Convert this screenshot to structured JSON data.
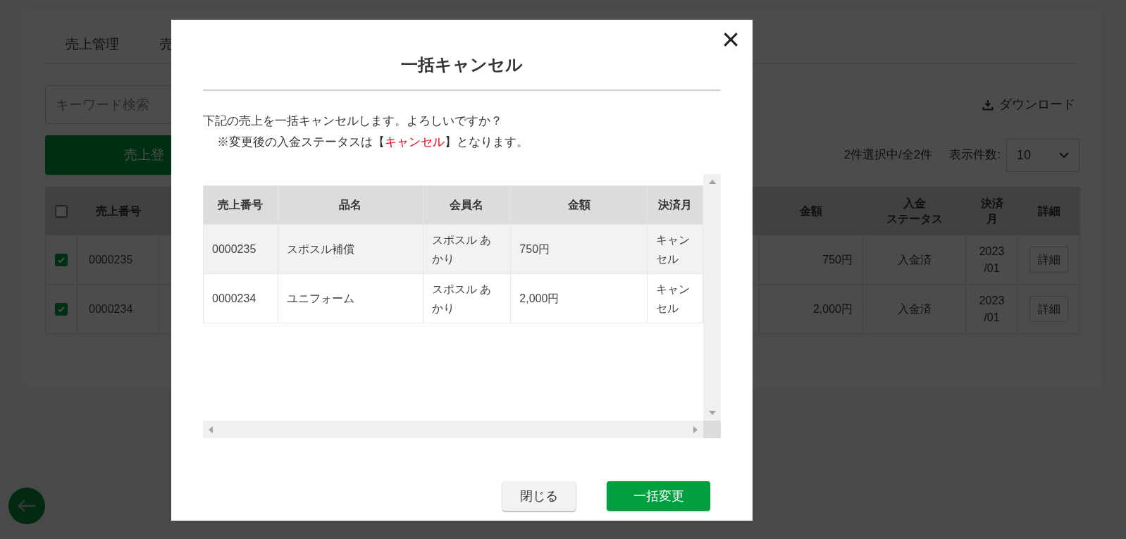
{
  "page": {
    "tabs": [
      "売上管理",
      "売"
    ],
    "search": {
      "placeholder": "キーワード検索"
    },
    "download": "ダウンロード",
    "register_button": "売上登",
    "selection_count": "2件選択中/全2件",
    "page_size": {
      "label": "表示件数:",
      "value": "10"
    },
    "table": {
      "header_checked": false,
      "columns": [
        {
          "lines": [
            "売上番号"
          ]
        },
        {
          "lines": [
            "金額"
          ]
        },
        {
          "lines": [
            "入金",
            "ステータス"
          ]
        },
        {
          "lines": [
            "決済",
            "月"
          ]
        },
        {
          "lines": [
            "詳細"
          ]
        }
      ],
      "rows": [
        {
          "checked": true,
          "number": "0000235",
          "amount": "750円",
          "status": "入金済",
          "month": [
            "2023",
            "/01"
          ],
          "detail": "詳細"
        },
        {
          "checked": true,
          "number": "0000234",
          "amount": "2,000円",
          "status": "入金済",
          "month": [
            "2023",
            "/01"
          ],
          "detail": "詳細"
        }
      ]
    }
  },
  "modal": {
    "title": "一括キャンセル",
    "close": "×",
    "message": "下記の売上を一括キャンセルします。よろしいですか？",
    "note": {
      "before": "※変更後の入金ステータスは【",
      "highlight": "キャンセル",
      "after": "】となります。"
    },
    "table": {
      "columns": [
        "売上番号",
        "品名",
        "会員名",
        "金額",
        "決済月"
      ],
      "rows": [
        {
          "cells": [
            "0000235",
            "スポスル補償",
            "スポスル あかり",
            "750円",
            "キャンセル"
          ]
        },
        {
          "cells": [
            "0000234",
            "ユニフォーム",
            "スポスル あかり",
            "2,000円",
            "キャンセル"
          ]
        }
      ]
    },
    "buttons": [
      {
        "kind": "secondary",
        "label": "閉じる"
      },
      {
        "kind": "primary",
        "label": "一括変更"
      }
    ]
  }
}
